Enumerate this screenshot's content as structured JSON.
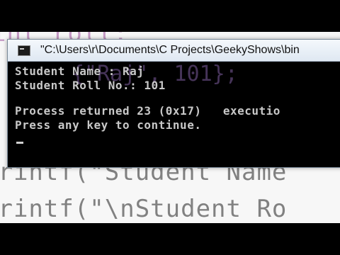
{
  "background_code": {
    "top_fragment": "int roll;",
    "line_1": "printf(\"Student Name",
    "line_2": "printf(\"\\nStudent Ro"
  },
  "console": {
    "title": "\"C:\\Users\\r\\Documents\\C Projects\\GeekyShows\\bin",
    "overlay_fragment": "{\"Raj\", 101};",
    "output": {
      "line_1": "Student Name : Raj",
      "line_2": "Student Roll No.: 101",
      "line_3": "Process returned 23 (0x17)   executio",
      "line_4": "Press any key to continue."
    }
  },
  "colors": {
    "console_bg": "#000000",
    "console_text": "#c8c8c8",
    "titlebar": "#e6eef6"
  }
}
